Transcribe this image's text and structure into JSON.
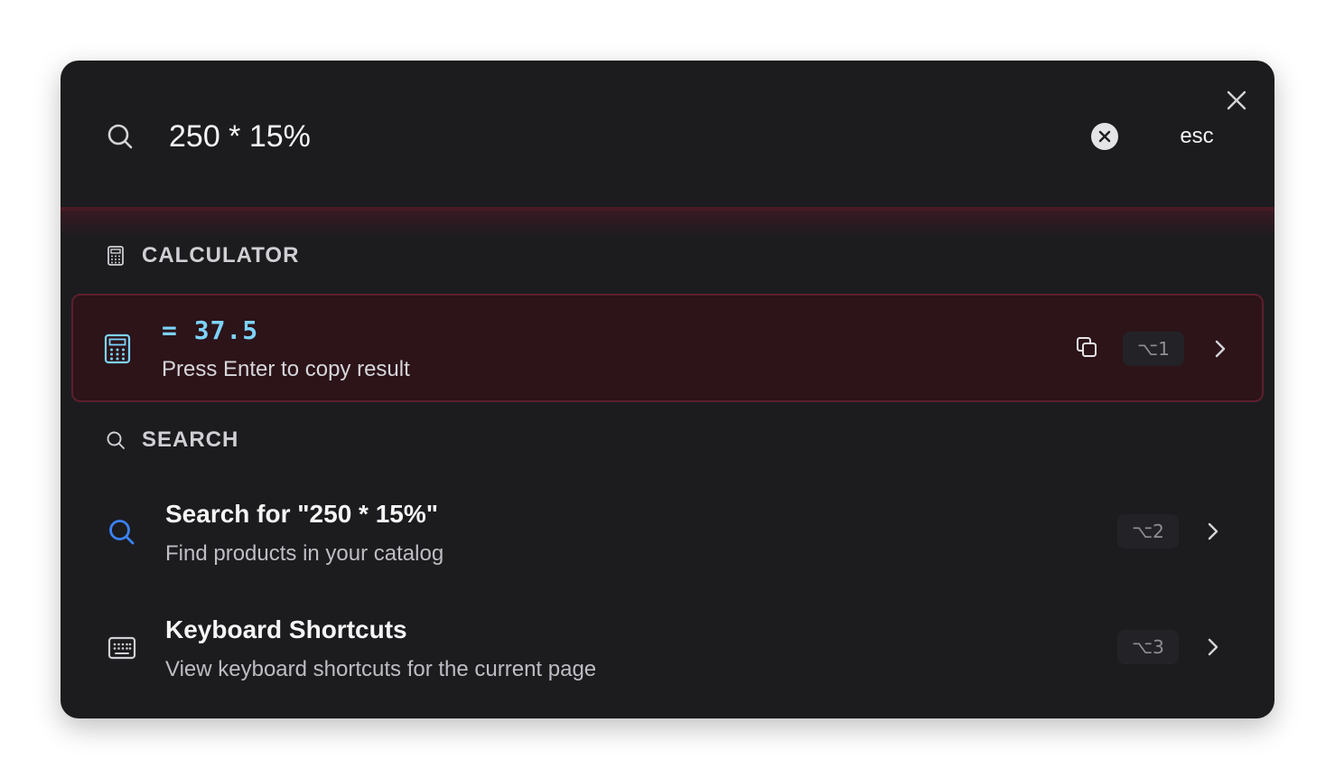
{
  "search": {
    "query": "250 * 15%",
    "esc_label": "esc"
  },
  "sections": {
    "calculator": {
      "heading": "CALCULATOR",
      "result": {
        "value": "= 37.5",
        "hint": "Press Enter to copy result",
        "shortcut": "⌥1"
      }
    },
    "search": {
      "heading": "SEARCH",
      "items": [
        {
          "title": "Search for \"250 * 15%\"",
          "subtitle": "Find products in your catalog",
          "shortcut": "⌥2",
          "icon": "search-icon"
        },
        {
          "title": "Keyboard Shortcuts",
          "subtitle": "View keyboard shortcuts for the current page",
          "shortcut": "⌥3",
          "icon": "keyboard-icon"
        }
      ]
    }
  },
  "colors": {
    "background": "#1c1c1f",
    "accent_result": "#7dd3fc",
    "search_icon_blue": "#3b82f6",
    "highlight_bg": "#2c1419",
    "highlight_border": "#5c1f2c"
  }
}
